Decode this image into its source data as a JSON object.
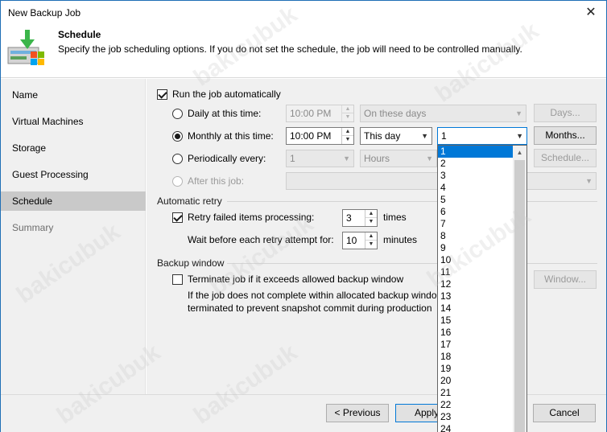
{
  "window": {
    "title": "New Backup Job",
    "close_glyph": "✕"
  },
  "header": {
    "title": "Schedule",
    "description": "Specify the job scheduling options. If you do not set the schedule, the job will need to be controlled manually.",
    "icon": "backup-job-download-icon"
  },
  "sidebar": {
    "items": [
      {
        "label": "Name",
        "state": "normal"
      },
      {
        "label": "Virtual Machines",
        "state": "normal"
      },
      {
        "label": "Storage",
        "state": "normal"
      },
      {
        "label": "Guest Processing",
        "state": "normal"
      },
      {
        "label": "Schedule",
        "state": "active"
      },
      {
        "label": "Summary",
        "state": "disabled"
      }
    ]
  },
  "schedule": {
    "run_auto_label": "Run the job automatically",
    "run_auto_checked": true,
    "daily": {
      "label": "Daily at this time:",
      "time": "10:00 PM",
      "days_option": "On these days",
      "button": "Days..."
    },
    "monthly": {
      "label": "Monthly at this time:",
      "time": "10:00 PM",
      "which": "This day",
      "day": "1",
      "button": "Months..."
    },
    "periodic": {
      "label": "Periodically every:",
      "value": "1",
      "unit": "Hours",
      "button": "Schedule..."
    },
    "after": {
      "label": "After this job:"
    }
  },
  "retry": {
    "section_label": "Automatic retry",
    "retry_label": "Retry failed items processing:",
    "retry_checked": true,
    "retry_value": "3",
    "retry_unit": "times",
    "wait_label": "Wait before each retry attempt for:",
    "wait_value": "10",
    "wait_unit": "minutes"
  },
  "backup_window": {
    "section_label": "Backup window",
    "terminate_label": "Terminate job if it exceeds allowed backup window",
    "terminate_checked": false,
    "help_line1": "If the job does not complete within allocated backup windo",
    "help_line2": "terminated to prevent snapshot commit during production",
    "button": "Window..."
  },
  "dropdown": {
    "options": [
      "1",
      "2",
      "3",
      "4",
      "5",
      "6",
      "7",
      "8",
      "9",
      "10",
      "11",
      "12",
      "13",
      "14",
      "15",
      "16",
      "17",
      "18",
      "19",
      "20",
      "21",
      "22",
      "23",
      "24"
    ],
    "selected": "1"
  },
  "footer": {
    "previous": "< Previous",
    "apply": "Apply",
    "cancel": "Cancel"
  },
  "watermark_text": "bakicubuk"
}
